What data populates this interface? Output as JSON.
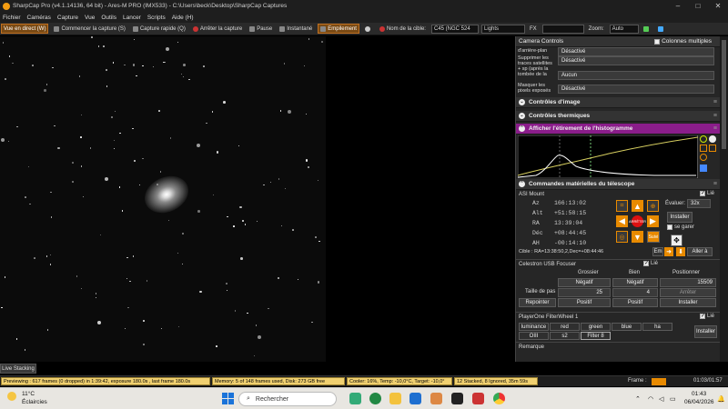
{
  "window": {
    "title": "SharpCap Pro (v4.1.14136, 64 bit) - Ares-M PRO (IMX533) - C:\\Users\\beck\\Desktop\\SharpCap Captures"
  },
  "menu": [
    "Fichier",
    "Caméras",
    "Capture",
    "Vue",
    "Outils",
    "Lancer",
    "Scripts",
    "Aide (H)"
  ],
  "toolbar": {
    "live_view": "Vue en direct (W)",
    "start_capture": "Commencer la capture (S)",
    "quick_capture": "Capture rapide (Q)",
    "stop_capture": "Arrêter la capture",
    "pause": "Pause",
    "snapshot": "Instantané",
    "stack": "Empilement",
    "target_name_label": "Nom de la cible:",
    "target_value": "C45 (NGC 524",
    "frame_type": "Lights",
    "fx_label": "FX",
    "zoom_label": "Zoom:",
    "zoom_value": "Auto"
  },
  "panel": {
    "camera_controls": {
      "title": "Camera Controls",
      "multi_columns": "Colonnes multiples",
      "rows": [
        {
          "label": "d'arrière-plan",
          "value": "Désactivé"
        },
        {
          "label": "Supprimer les traces satellites + sp (après la tombée de la nuit/le réel)",
          "value": "Désactivé"
        },
        {
          "label": "",
          "value": "Aucun"
        },
        {
          "label": "Masquer les pixels exposés",
          "value": "Désactivé"
        }
      ]
    },
    "image_controls": "Contrôles d'image",
    "thermal_controls": "Contrôles thermiques",
    "histogram": "Afficher l'étirement de l'histogramme",
    "telescope": {
      "title": "Commandes matérielles du télescope",
      "mount": "ASI Mount",
      "linked": "Lié",
      "readouts": [
        {
          "name": "Az",
          "value": "166:13:02"
        },
        {
          "name": "Alt",
          "value": "+51:58:15"
        },
        {
          "name": "RA",
          "value": "13:39:04"
        },
        {
          "name": "Déc",
          "value": "+08:44:45"
        },
        {
          "name": "AH",
          "value": "-00:14:10"
        }
      ],
      "rate_label": "Évaluer:",
      "rate_value": "32x",
      "install": "Installer",
      "park": "se garer",
      "stop": "ARRÊTER",
      "track": "Suivi",
      "target": "Cible : RA=13:38:50,2,Dec=+08:44:46",
      "en": "Em",
      "goto": "Aller à"
    },
    "focuser": {
      "title": "Celestron USB Focuser",
      "linked": "Lié",
      "col_coarse": "Grossier",
      "col_fine": "Bien",
      "col_position": "Positionner",
      "negative": "Négatif",
      "positive": "Positif",
      "position": "15509",
      "step_label": "Taille de pas",
      "coarse_step": "25",
      "fine_step": "4",
      "stop": "Arrêter",
      "reset": "Repointer",
      "install": "Installer"
    },
    "filterwheel": {
      "title": "PlayerOne FilterWheel 1",
      "linked": "Lié",
      "filters": [
        "luminance",
        "red",
        "green",
        "blue",
        "ha",
        "OIII",
        "s2",
        "Filter 8"
      ],
      "install": "Installer"
    },
    "remarks": "Remarque"
  },
  "live_stacking": "Live Stacking",
  "status": {
    "preview": "Previewing : 617 frames (0 dropped) in 1:39:42, exposure 180.0s , last frame 180.0s",
    "memory": "Memory: 5 of 148 frames used, Disk: 273 GB free",
    "cooler": "Cooler: 16%, Temp: -10,0°C, Target: -10,0°",
    "stacked": "12 Stacked, 8 Ignored, 35m 59s",
    "frame_label": "Frame :",
    "elapsed": "01:03/01:57"
  },
  "taskbar": {
    "weather_temp": "11°C",
    "weather_desc": "Éclaircies",
    "search": "Rechercher",
    "time": "01:43",
    "date": "06/04/2026"
  },
  "colors": {
    "accent": "#e88a00",
    "purple": "#8a1d8a",
    "status": "#f0d070"
  }
}
